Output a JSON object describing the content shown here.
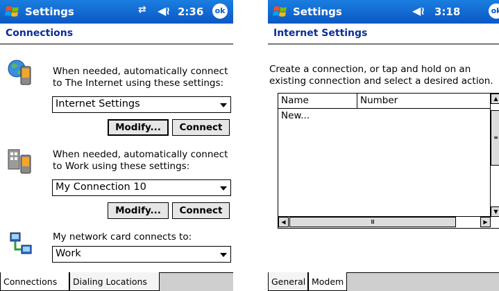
{
  "colors": {
    "titlebar": "#0a58c4",
    "subheading": "#0c2d99",
    "tab_strip": "#cfcfcf"
  },
  "left": {
    "title": "Settings",
    "status_time": "2:36",
    "ok_label": "ok",
    "subheading": "Connections",
    "internet_text": "When needed, automatically connect to The Internet using these settings:",
    "internet_select": "Internet Settings",
    "modify_label": "Modify...",
    "connect_label": "Connect",
    "work_text": "When needed, automatically connect to Work using these settings:",
    "work_select": "My Connection 10",
    "network_text": "My network card connects to:",
    "network_select": "Work",
    "tabs": [
      "Connections",
      "Dialing Locations"
    ]
  },
  "right": {
    "title": "Settings",
    "status_time": "3:18",
    "ok_label": "ok",
    "subheading": "Internet Settings",
    "instructions": "Create a connection, or tap and hold on an existing connection and select a desired action.",
    "columns": [
      "Name",
      "Number"
    ],
    "rows": [
      "New..."
    ],
    "tabs": [
      "General",
      "Modem"
    ]
  }
}
